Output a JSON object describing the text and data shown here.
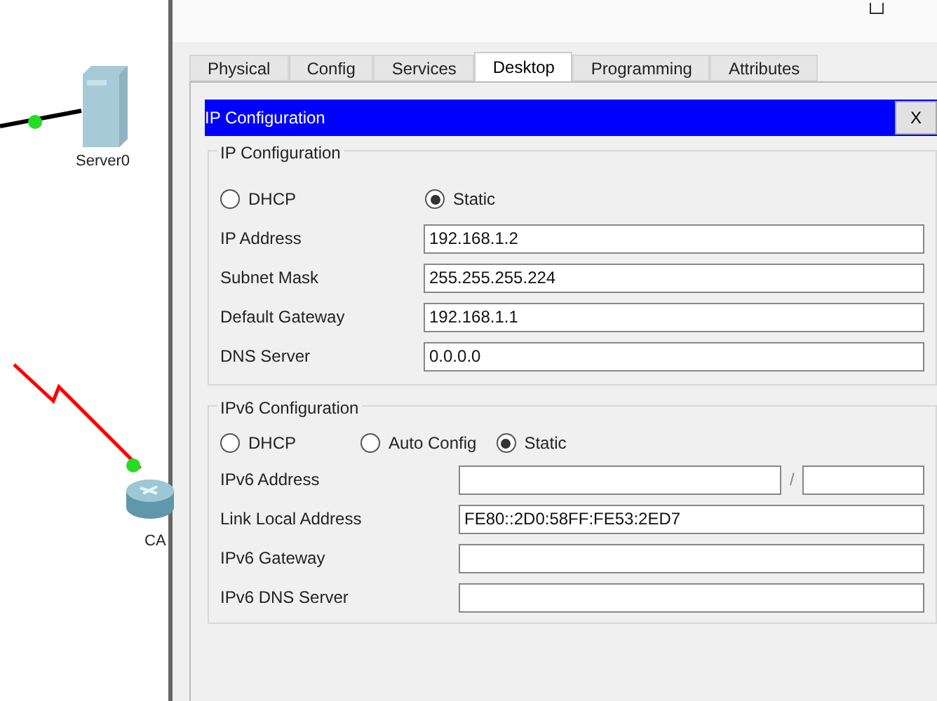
{
  "canvas": {
    "devices": [
      {
        "kind": "server",
        "label": "Server0"
      },
      {
        "kind": "router",
        "label": "CA"
      }
    ]
  },
  "tabs": [
    {
      "label": "Physical",
      "selected": false
    },
    {
      "label": "Config",
      "selected": false
    },
    {
      "label": "Services",
      "selected": false
    },
    {
      "label": "Desktop",
      "selected": true
    },
    {
      "label": "Programming",
      "selected": false
    },
    {
      "label": "Attributes",
      "selected": false
    }
  ],
  "panel": {
    "title": "IP Configuration",
    "close": "X"
  },
  "ipv4": {
    "title": "IP Configuration",
    "modes": [
      {
        "label": "DHCP",
        "selected": false
      },
      {
        "label": "Static",
        "selected": true
      }
    ],
    "fields": [
      {
        "label": "IP Address",
        "value": "192.168.1.2"
      },
      {
        "label": "Subnet Mask",
        "value": "255.255.255.224"
      },
      {
        "label": "Default Gateway",
        "value": "192.168.1.1"
      },
      {
        "label": "DNS Server",
        "value": "0.0.0.0"
      }
    ]
  },
  "ipv6": {
    "title": "IPv6 Configuration",
    "modes": [
      {
        "label": "DHCP",
        "selected": false
      },
      {
        "label": "Auto Config",
        "selected": false
      },
      {
        "label": "Static",
        "selected": true
      }
    ],
    "fields": [
      {
        "label": "IPv6 Address",
        "kind": "prefix",
        "separator": "/"
      },
      {
        "label": "Link Local Address",
        "value": "FE80::2D0:58FF:FE53:2ED7"
      },
      {
        "label": "IPv6 Gateway"
      },
      {
        "label": "IPv6 DNS Server"
      }
    ]
  }
}
